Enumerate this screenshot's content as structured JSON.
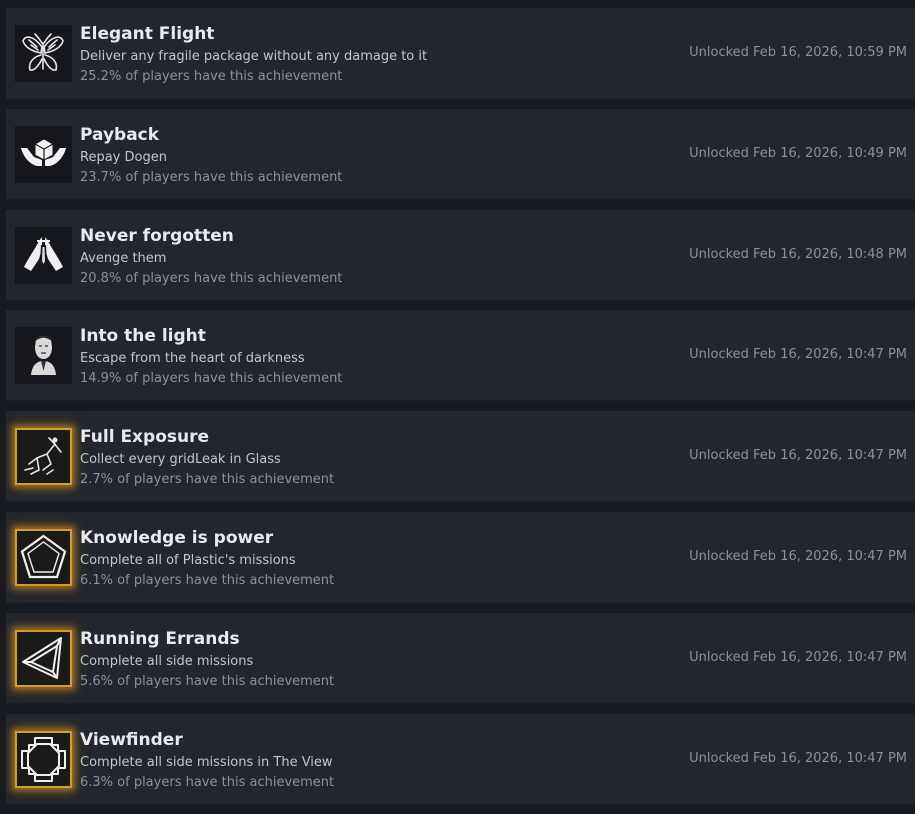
{
  "achievements": [
    {
      "title": "Elegant Flight",
      "description": "Deliver any fragile package without any damage to it",
      "percent": "25.2% of players have this achievement",
      "unlocked": "Unlocked Feb 16, 2026, 10:59 PM",
      "icon": "butterfly-icon",
      "rare": false
    },
    {
      "title": "Payback",
      "description": "Repay Dogen",
      "percent": "23.7% of players have this achievement",
      "unlocked": "Unlocked Feb 16, 2026, 10:49 PM",
      "icon": "hands-holding-cube-icon",
      "rare": false
    },
    {
      "title": "Never forgotten",
      "description": "Avenge them",
      "percent": "20.8% of players have this achievement",
      "unlocked": "Unlocked Feb 16, 2026, 10:48 PM",
      "icon": "praying-hands-icon",
      "rare": false
    },
    {
      "title": "Into the light",
      "description": "Escape from the heart of darkness",
      "percent": "14.9% of players have this achievement",
      "unlocked": "Unlocked Feb 16, 2026, 10:47 PM",
      "icon": "portrait-icon",
      "rare": false
    },
    {
      "title": "Full Exposure",
      "description": "Collect every gridLeak in Glass",
      "percent": "2.7% of players have this achievement",
      "unlocked": "Unlocked Feb 16, 2026, 10:47 PM",
      "icon": "runner-icon",
      "rare": true
    },
    {
      "title": "Knowledge is power",
      "description": "Complete all of Plastic's missions",
      "percent": "6.1% of players have this achievement",
      "unlocked": "Unlocked Feb 16, 2026, 10:47 PM",
      "icon": "pentagon-icon",
      "rare": true
    },
    {
      "title": "Running Errands",
      "description": "Complete all side missions",
      "percent": "5.6% of players have this achievement",
      "unlocked": "Unlocked Feb 16, 2026, 10:47 PM",
      "icon": "triangle-icon",
      "rare": true
    },
    {
      "title": "Viewfinder",
      "description": "Complete all side missions in The View",
      "percent": "6.3% of players have this achievement",
      "unlocked": "Unlocked Feb 16, 2026, 10:47 PM",
      "icon": "octagon-frame-icon",
      "rare": true
    }
  ]
}
